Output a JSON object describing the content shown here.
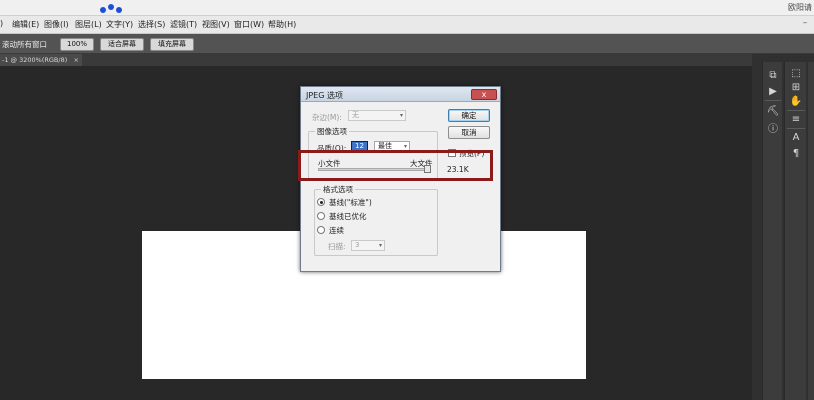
{
  "top_strip": {
    "right_title": "欧阳请"
  },
  "menu": {
    "items": [
      "编辑(E)",
      "图像(I)",
      "图层(L)",
      "文字(Y)",
      "选择(S)",
      "滤镜(T)",
      "视图(V)",
      "窗口(W)",
      "帮助(H)"
    ],
    "lead": ")",
    "window_control": "–"
  },
  "options_bar": {
    "label": "滚动所有窗口",
    "buttons": [
      "100%",
      "适合屏幕",
      "填充屏幕"
    ]
  },
  "document_tab": {
    "label": "-1 @ 3200%(RGB/8)",
    "close": "×"
  },
  "dialog": {
    "title": "JPEG 选项",
    "close_icon": "x",
    "matte_label": "杂边(M):",
    "matte_value": "无",
    "image_options_caption": "图像选项",
    "quality_label": "品质(Q):",
    "quality_value": "12",
    "quality_preset": "最佳",
    "small_file_label": "小文件",
    "large_file_label": "大文件",
    "format_caption": "格式选项",
    "format_options": [
      "基线(\"标准\")",
      "基线已优化",
      "连续"
    ],
    "format_selected_index": 0,
    "scans_label": "扫描:",
    "scans_value": "3",
    "ok_button": "确定",
    "cancel_button": "取消",
    "preview_label": "预览(P)",
    "file_size": "23.1K"
  },
  "colors": {
    "highlight": "#8b1b1b",
    "logo": "#1e4fd8"
  }
}
